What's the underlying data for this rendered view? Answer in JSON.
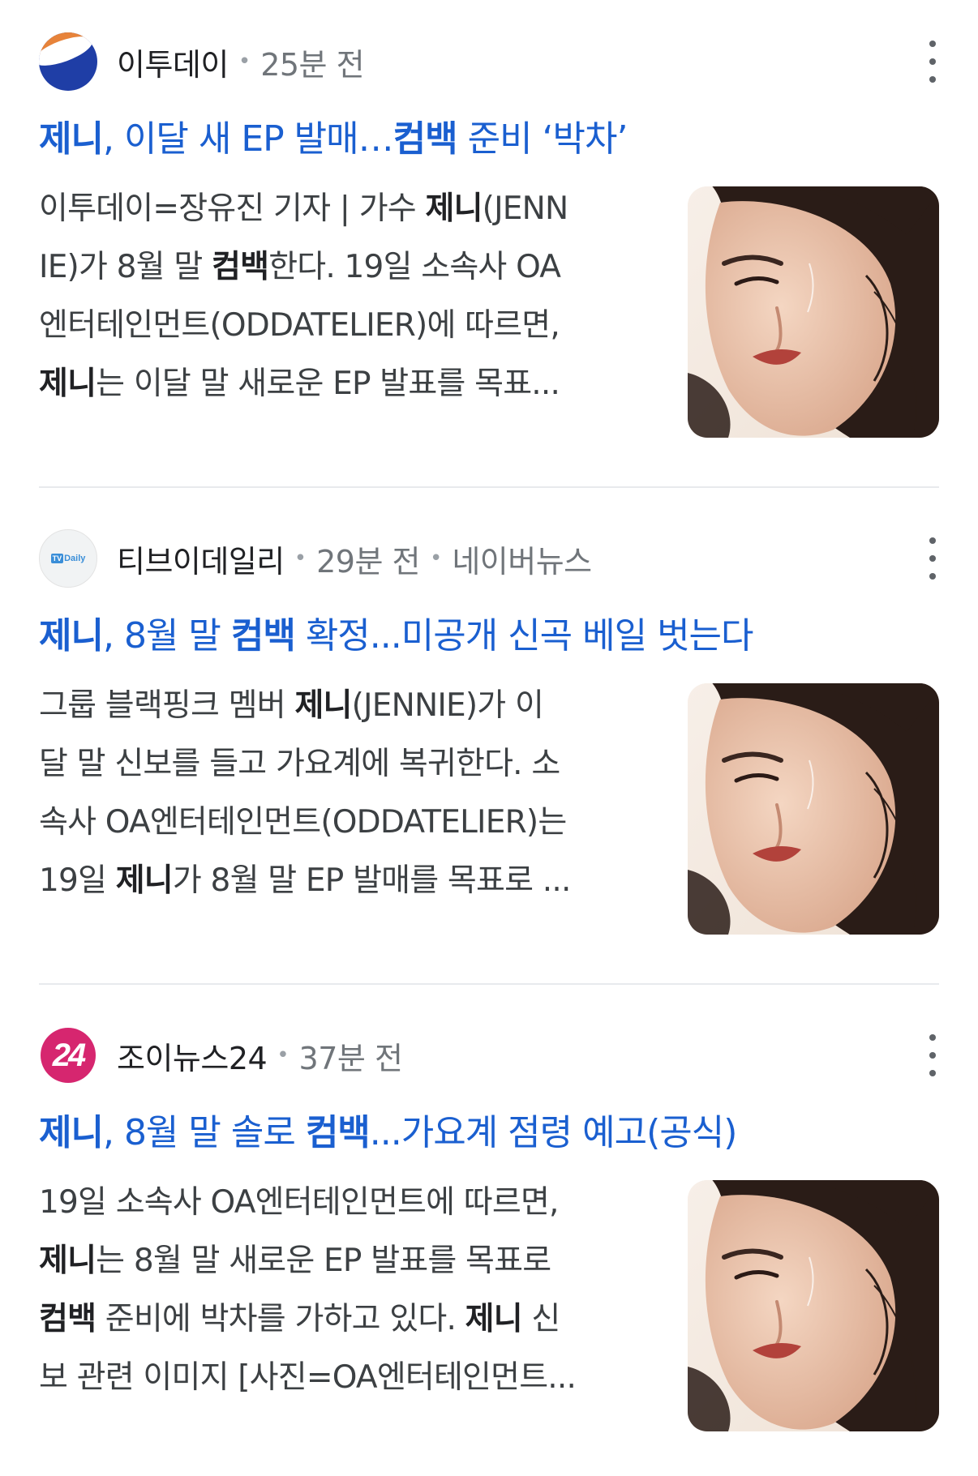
{
  "articles": [
    {
      "source": "이투데이",
      "logo_icon": "etoday-logo-icon",
      "time": "25분 전",
      "via": "",
      "headline": [
        {
          "t": "제니",
          "b": true
        },
        {
          "t": ", 이달 새 EP 발매…",
          "b": false
        },
        {
          "t": "컴백",
          "b": true
        },
        {
          "t": " 준비 ‘박차’",
          "b": false
        }
      ],
      "snippet": [
        [
          {
            "t": "이투데이=장유진 기자 | 가수 ",
            "b": false
          },
          {
            "t": "제니",
            "b": true
          },
          {
            "t": "(JENN",
            "b": false
          }
        ],
        [
          {
            "t": "IE)가 8월 말 ",
            "b": false
          },
          {
            "t": "컴백",
            "b": true
          },
          {
            "t": "한다. 19일 소속사 OA",
            "b": false
          }
        ],
        [
          {
            "t": "엔터테인먼트(ODDATELIER)에 따르면,",
            "b": false
          }
        ],
        [
          {
            "t": "제니",
            "b": true
          },
          {
            "t": "는 이달 말 새로운 EP 발표를 목표...",
            "b": false
          }
        ]
      ],
      "thumbnail_alt": "제니 신보 관련 이미지"
    },
    {
      "source": "티브이데일리",
      "logo_icon": "tvdaily-logo-icon",
      "logo_text": "TV Daily",
      "time": "29분 전",
      "via": "네이버뉴스",
      "headline": [
        {
          "t": "제니",
          "b": true
        },
        {
          "t": ", 8월 말 ",
          "b": false
        },
        {
          "t": "컴백",
          "b": true
        },
        {
          "t": " 확정...미공개 신곡 베일 벗는다",
          "b": false
        }
      ],
      "snippet": [
        [
          {
            "t": "그룹 블랙핑크 멤버 ",
            "b": false
          },
          {
            "t": "제니",
            "b": true
          },
          {
            "t": "(JENNIE)가 이",
            "b": false
          }
        ],
        [
          {
            "t": "달 말 신보를 들고 가요계에 복귀한다. 소",
            "b": false
          }
        ],
        [
          {
            "t": "속사 OA엔터테인먼트(ODDATELIER)는",
            "b": false
          }
        ],
        [
          {
            "t": "19일 ",
            "b": false
          },
          {
            "t": "제니",
            "b": true
          },
          {
            "t": "가 8월 말 EP 발매를 목표로 ...",
            "b": false
          }
        ]
      ],
      "thumbnail_alt": "제니 신보 관련 이미지"
    },
    {
      "source": "조이뉴스24",
      "logo_icon": "joynews24-logo-icon",
      "logo_text": "24",
      "time": "37분 전",
      "via": "",
      "headline": [
        {
          "t": "제니",
          "b": true
        },
        {
          "t": ", 8월 말 솔로 ",
          "b": false
        },
        {
          "t": "컴백",
          "b": true
        },
        {
          "t": "...가요계 점령 예고(공식)",
          "b": false
        }
      ],
      "snippet": [
        [
          {
            "t": "19일 소속사 OA엔터테인먼트에 따르면,",
            "b": false
          }
        ],
        [
          {
            "t": "제니",
            "b": true
          },
          {
            "t": "는 8월 말 새로운 EP 발표를 목표로",
            "b": false
          }
        ],
        [
          {
            "t": "컴백",
            "b": true
          },
          {
            "t": " 준비에 박차를 가하고 있다. ",
            "b": false
          },
          {
            "t": "제니",
            "b": true
          },
          {
            "t": " 신",
            "b": false
          }
        ],
        [
          {
            "t": "보 관련 이미지 [사진=OA엔터테인먼트...",
            "b": false
          }
        ]
      ],
      "thumbnail_alt": "제니 신보 관련 이미지"
    }
  ],
  "ui": {
    "separator_glyph": "•",
    "more_icon": "more-vert-icon"
  },
  "colors": {
    "headline_link": "#1a5fd0",
    "meta_text": "#70757a",
    "divider": "#e8eaed"
  }
}
